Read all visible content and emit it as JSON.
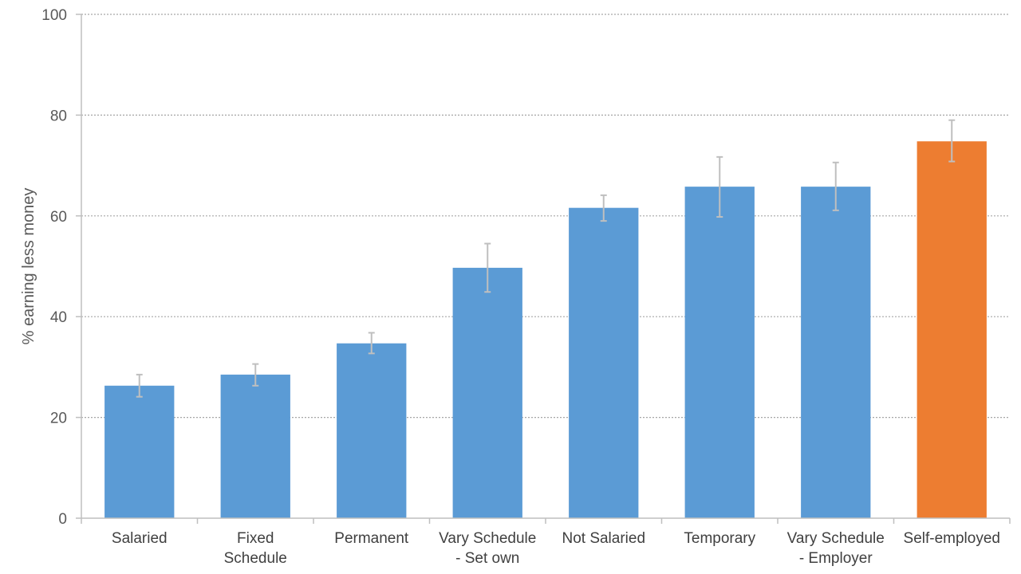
{
  "chart_data": {
    "type": "bar",
    "title": "",
    "xlabel": "",
    "ylabel": "% earning less money",
    "ylim": [
      0,
      100
    ],
    "yticks": [
      0,
      20,
      40,
      60,
      80,
      100
    ],
    "grid": true,
    "legend": "none",
    "categories": [
      [
        "Salaried"
      ],
      [
        "Fixed",
        "Schedule"
      ],
      [
        "Permanent"
      ],
      [
        "Vary Schedule",
        "- Set own"
      ],
      [
        "Not Salaried"
      ],
      [
        "Temporary"
      ],
      [
        "Vary Schedule",
        "- Employer"
      ],
      [
        "Self-employed"
      ]
    ],
    "values": [
      26.3,
      28.5,
      34.7,
      49.7,
      61.6,
      65.8,
      65.8,
      74.8
    ],
    "error_low": [
      24.1,
      26.3,
      32.7,
      44.9,
      59.0,
      59.8,
      61.1,
      70.8
    ],
    "error_high": [
      28.5,
      30.6,
      36.8,
      54.5,
      64.1,
      71.7,
      70.6,
      79.0
    ],
    "bar_colors": [
      "#5B9BD5",
      "#5B9BD5",
      "#5B9BD5",
      "#5B9BD5",
      "#5B9BD5",
      "#5B9BD5",
      "#5B9BD5",
      "#ED7D31"
    ],
    "colors": {
      "default_bar": "#5B9BD5",
      "highlight_bar": "#ED7D31",
      "error_bar": "#BFBFBF",
      "axis": "#BFBFBF",
      "grid": "#A6A6A6"
    }
  }
}
